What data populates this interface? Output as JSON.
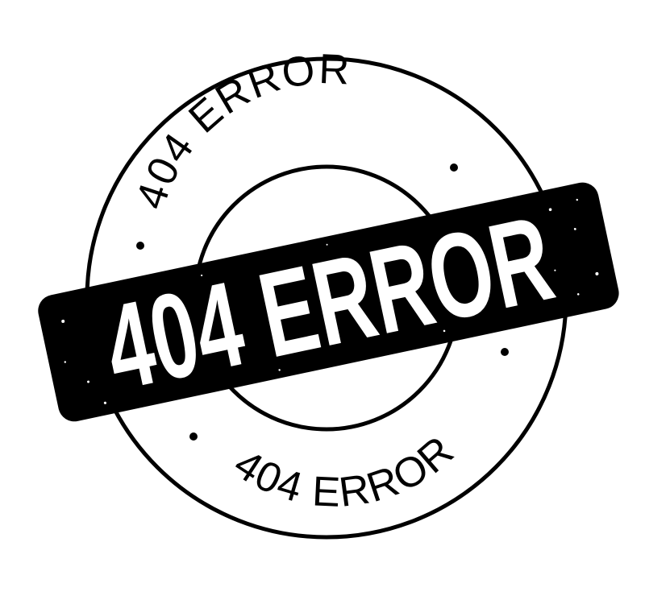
{
  "stamp": {
    "top_text": "404 ERROR",
    "bottom_text": "404 ERROR",
    "banner_text": "404 ERROR",
    "ink_color": "#000000",
    "paper_color": "#ffffff"
  }
}
